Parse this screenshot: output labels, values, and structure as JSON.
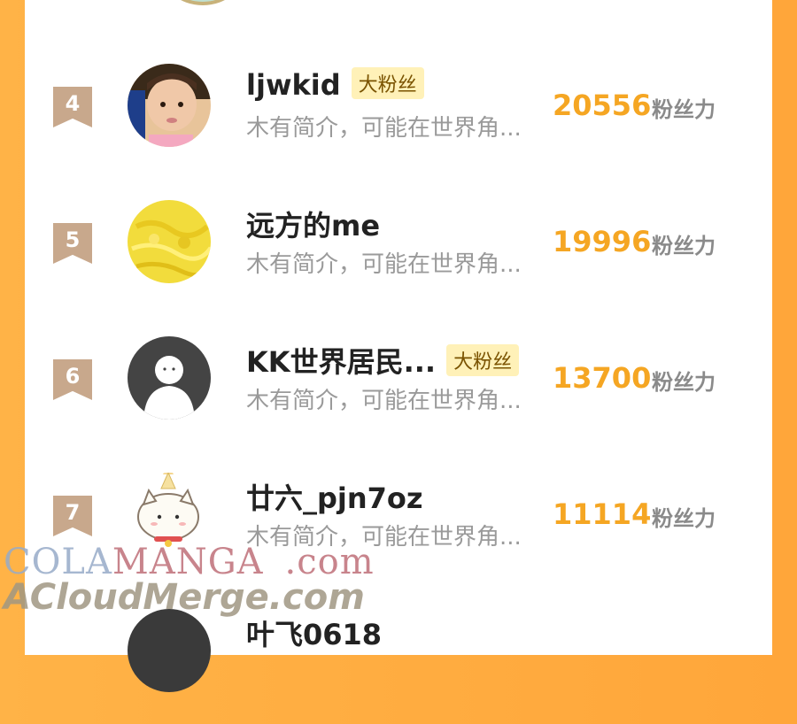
{
  "unit_label": "粉丝力",
  "badge_label": "大粉丝",
  "rows": [
    {
      "rank": "4",
      "name": "ljwkid",
      "badge": "大粉丝",
      "intro": "木有简介，可能在世界角...",
      "score": "20556",
      "avatar": "child-photo"
    },
    {
      "rank": "5",
      "name": "远方的me",
      "badge": "",
      "intro": "木有简介，可能在世界角...",
      "score": "19996",
      "avatar": "yellow-texture"
    },
    {
      "rank": "6",
      "name": "KK世界居民...",
      "badge": "大粉丝",
      "intro": "木有简介，可能在世界角...",
      "score": "13700",
      "avatar": "default-user"
    },
    {
      "rank": "7",
      "name": "廿六_pjn7oz",
      "badge": "",
      "intro": "木有简介，可能在世界角...",
      "score": "11114",
      "avatar": "cat-cartoon"
    },
    {
      "rank": "",
      "name": "叶飞0618",
      "badge": "",
      "intro": "",
      "score": "",
      "avatar": "dark-circle"
    }
  ],
  "watermark": {
    "line1_prefix": "COLA",
    "line1_main": "MANGA",
    "line1_suffix": ".com",
    "line2": "ACloudMerge.com"
  },
  "colors": {
    "background": "#ffa63a",
    "score": "#f5a623",
    "rank_badge": "#c8a88c",
    "fan_badge_bg": "#fff1b8"
  }
}
